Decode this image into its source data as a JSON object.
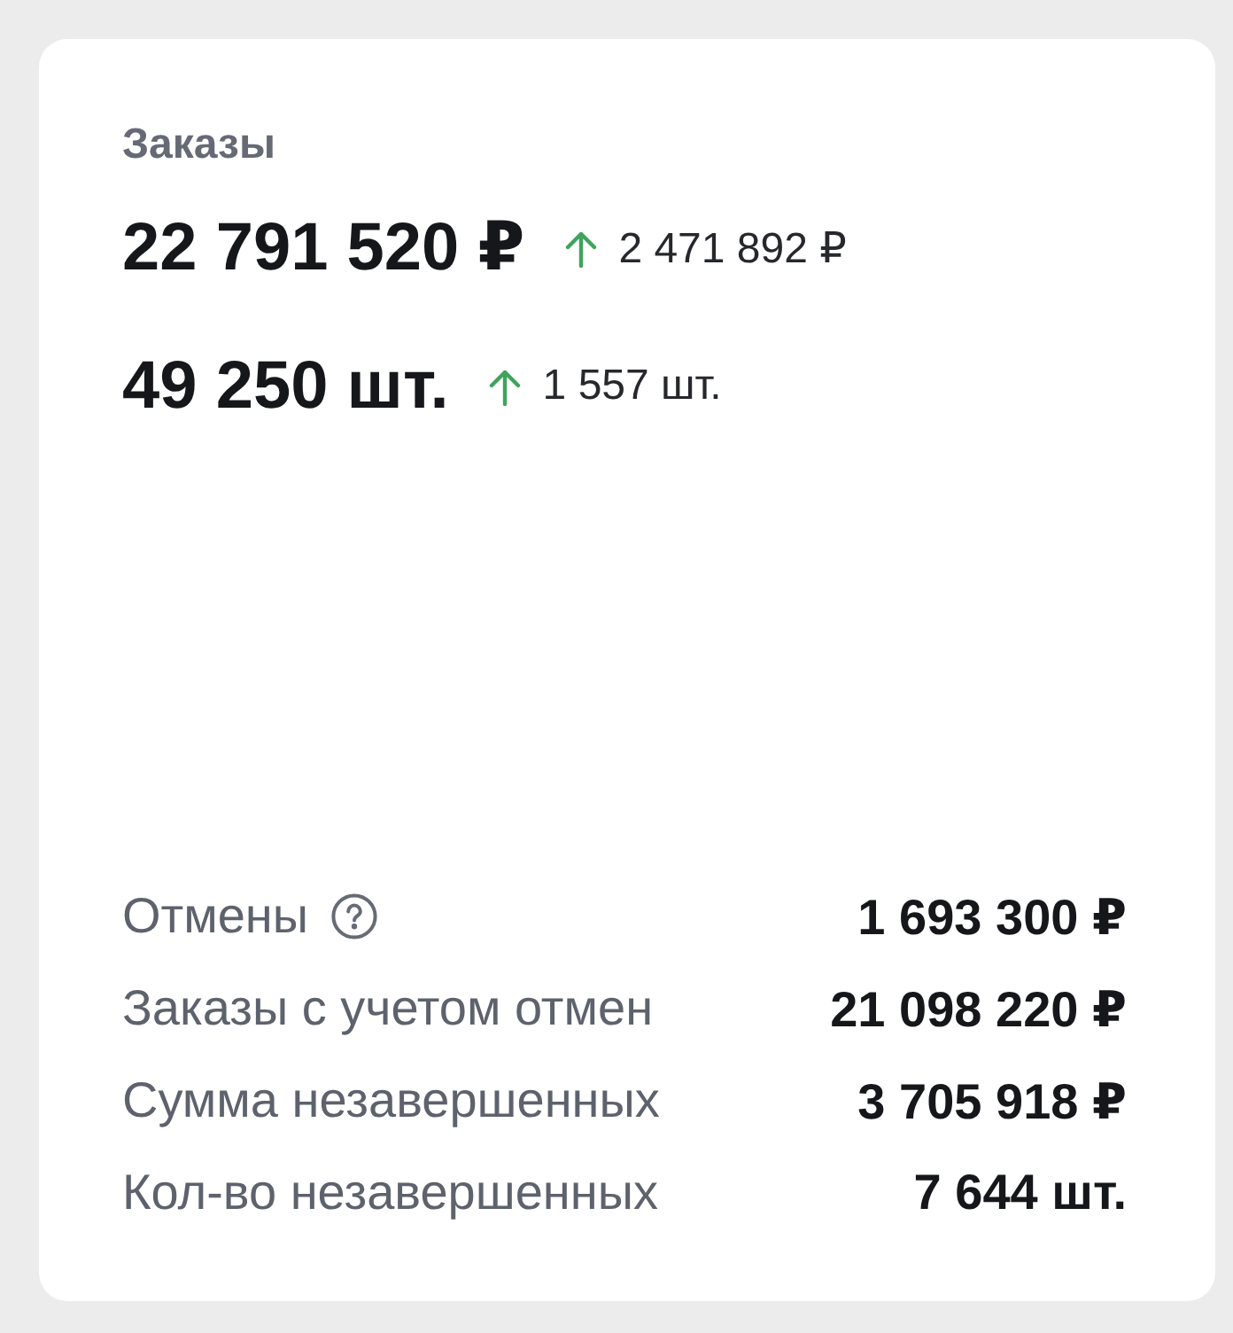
{
  "card": {
    "title": "Заказы",
    "metrics": [
      {
        "value": "22 791 520 ₽",
        "change": {
          "kind": "up",
          "text": "2 471 892 ₽"
        }
      },
      {
        "value": "49 250 шт.",
        "change": {
          "kind": "up",
          "text": "1 557 шт."
        }
      }
    ],
    "details": [
      {
        "label": "Отмены",
        "help": true,
        "value": "1 693 300 ₽"
      },
      {
        "label": "Заказы с учетом отмен",
        "help": false,
        "value": "21 098 220 ₽"
      },
      {
        "label": "Сумма незавершенных",
        "help": false,
        "value": "3 705 918 ₽"
      },
      {
        "label": "Кол-во незавершенных",
        "help": false,
        "value": "7 644 шт."
      }
    ]
  }
}
